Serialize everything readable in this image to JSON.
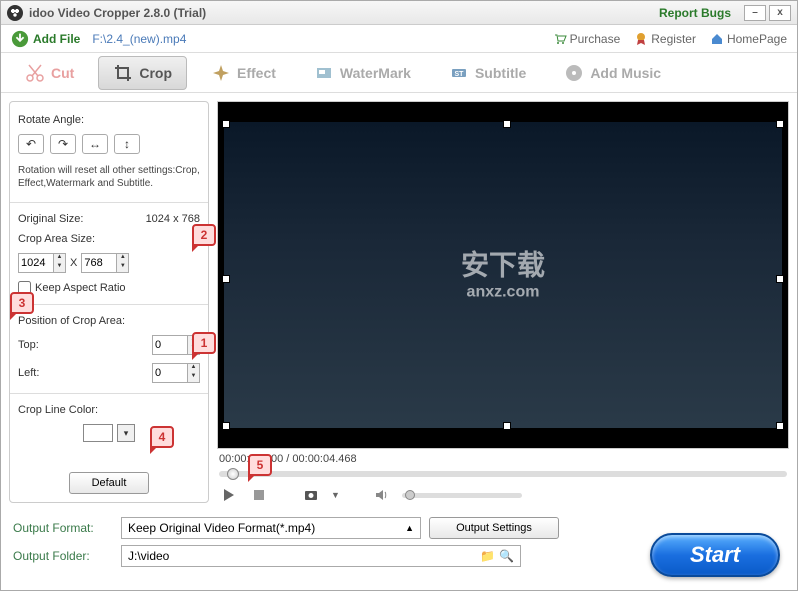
{
  "title": "idoo Video Cropper 2.8.0 (Trial)",
  "report_bugs": "Report Bugs",
  "add_file": "Add File",
  "file_path": "F:\\2.4_(new).mp4",
  "toolbar_links": {
    "purchase": "Purchase",
    "register": "Register",
    "homepage": "HomePage"
  },
  "tabs": {
    "cut": "Cut",
    "crop": "Crop",
    "effect": "Effect",
    "watermark": "WaterMark",
    "subtitle": "Subtitle",
    "addmusic": "Add Music"
  },
  "left": {
    "rotate_label": "Rotate Angle:",
    "rotate_note": "Rotation will reset all other settings:Crop, Effect,Watermark and Subtitle.",
    "original_size_label": "Original Size:",
    "original_size_value": "1024 x 768",
    "crop_area_label": "Crop Area Size:",
    "crop_w": "1024",
    "crop_h": "768",
    "x_sep": "X",
    "keep_aspect": "Keep Aspect Ratio",
    "position_label": "Position of Crop Area:",
    "top_label": "Top:",
    "top_val": "0",
    "left_label": "Left:",
    "left_val": "0",
    "crop_color_label": "Crop Line Color:",
    "default_btn": "Default"
  },
  "preview": {
    "watermark_line1": "安下载",
    "watermark_line2": "anxz.com",
    "timecode": "00:00:00.000 / 00:00:04.468"
  },
  "bottom": {
    "output_format_label": "Output Format:",
    "output_format_value": "Keep Original Video Format(*.mp4)",
    "output_settings": "Output Settings",
    "output_folder_label": "Output Folder:",
    "output_folder_value": "J:\\video",
    "start": "Start"
  },
  "annotations": {
    "a1": "1",
    "a2": "2",
    "a3": "3",
    "a4": "4",
    "a5": "5"
  }
}
